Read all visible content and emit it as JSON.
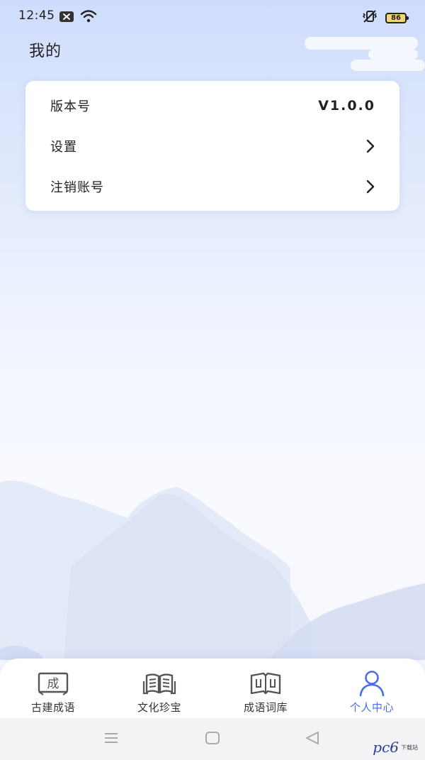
{
  "status_bar": {
    "time": "12:45",
    "battery_level": "86",
    "icons": [
      "close-notification-icon",
      "wifi-icon",
      "vibrate-mute-icon",
      "battery-icon"
    ]
  },
  "page": {
    "title": "我的"
  },
  "menu": {
    "items": [
      {
        "label": "版本号",
        "value": "V1.0.0",
        "icon": null
      },
      {
        "label": "设置",
        "value": null,
        "icon": "chevron-right-icon"
      },
      {
        "label": "注销账号",
        "value": null,
        "icon": "chevron-right-icon"
      }
    ]
  },
  "bottom_nav": {
    "active_index": 3,
    "active_color": "#4a6cf0",
    "items": [
      {
        "label": "古建成语",
        "icon": "idiom-frame-icon",
        "icon_char": "成"
      },
      {
        "label": "文化珍宝",
        "icon": "open-book-icon"
      },
      {
        "label": "成语词库",
        "icon": "idiom-book-icon"
      },
      {
        "label": "个人中心",
        "icon": "user-icon"
      }
    ]
  },
  "system_nav": {
    "icons": [
      "menu-icon",
      "home-icon",
      "back-icon"
    ]
  },
  "watermark": {
    "text": "pc6",
    "sub": "下载站"
  }
}
